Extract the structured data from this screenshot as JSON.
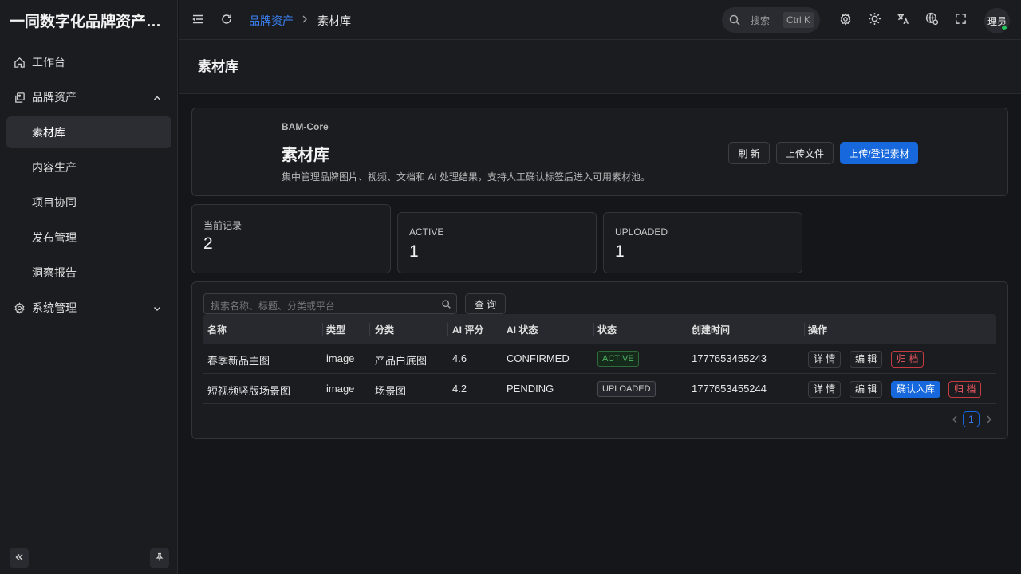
{
  "app": {
    "title": "一同数字化品牌资产管理平台"
  },
  "sidebar": {
    "items": [
      {
        "label": "工作台",
        "icon": "home-icon"
      },
      {
        "label": "品牌资产",
        "icon": "assets-icon",
        "expanded": true
      },
      {
        "label": "素材库",
        "active": true
      },
      {
        "label": "内容生产"
      },
      {
        "label": "项目协同"
      },
      {
        "label": "发布管理"
      },
      {
        "label": "洞察报告"
      },
      {
        "label": "系统管理",
        "icon": "gear-icon",
        "expanded": false
      }
    ]
  },
  "header": {
    "breadcrumb": [
      "品牌资产",
      "素材库"
    ],
    "search_label": "搜索",
    "search_shortcut": "Ctrl K",
    "user": "理员"
  },
  "page": {
    "title": "素材库"
  },
  "hero": {
    "kicker": "BAM-Core",
    "title": "素材库",
    "description": "集中管理品牌图片、视频、文档和 AI 处理结果，支持人工确认标签后进入可用素材池。",
    "buttons": {
      "refresh": "刷 新",
      "upload_file": "上传文件",
      "register": "上传/登记素材"
    }
  },
  "stats": [
    {
      "label": "当前记录",
      "value": "2"
    },
    {
      "label": "ACTIVE",
      "value": "1"
    },
    {
      "label": "UPLOADED",
      "value": "1"
    }
  ],
  "table": {
    "search_placeholder": "搜索名称、标题、分类或平台",
    "query_label": "查 询",
    "columns": [
      "名称",
      "类型",
      "分类",
      "AI 评分",
      "AI 状态",
      "状态",
      "创建时间",
      "操作"
    ],
    "rows": [
      {
        "name": "春季新品主图",
        "type": "image",
        "category": "产品白底图",
        "ai_score": "4.6",
        "ai_status": "CONFIRMED",
        "status": "ACTIVE",
        "created": "1777653455243",
        "actions": {
          "detail": "详 情",
          "edit": "编 辑",
          "archive": "归 档"
        }
      },
      {
        "name": "短视频竖版场景图",
        "type": "image",
        "category": "场景图",
        "ai_score": "4.2",
        "ai_status": "PENDING",
        "status": "UPLOADED",
        "created": "1777653455244",
        "actions": {
          "detail": "详 情",
          "edit": "编 辑",
          "confirm": "确认入库",
          "archive": "归 档"
        }
      }
    ],
    "pagination": {
      "current": "1"
    }
  },
  "colors": {
    "accent": "#1668dc",
    "success": "#22c55e",
    "danger": "#e8555d"
  }
}
